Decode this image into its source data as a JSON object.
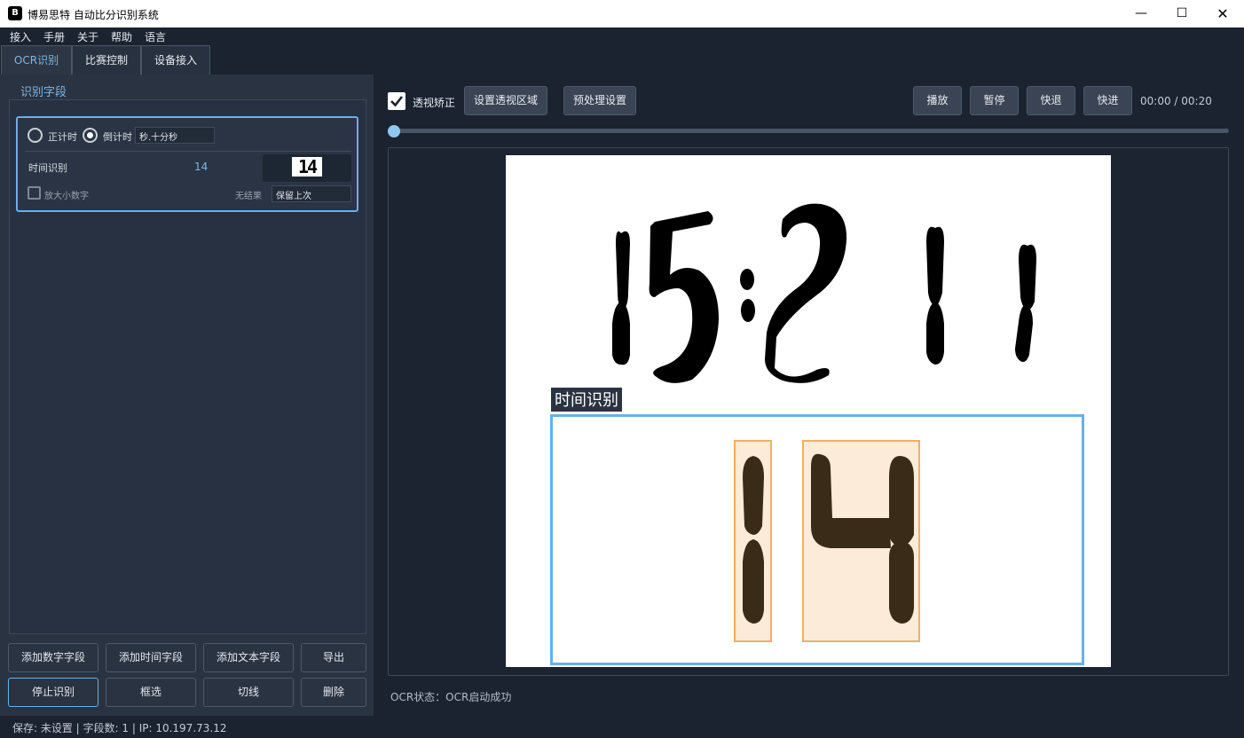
{
  "window": {
    "title": "博易思特 自动比分识别系统",
    "logo": "B",
    "minimize_icon": "minimize-icon",
    "maximize_icon": "maximize-icon",
    "close_icon": "close-icon"
  },
  "menu": [
    "接入",
    "手册",
    "关于",
    "帮助",
    "语言"
  ],
  "tabs": [
    {
      "label": "OCR识别",
      "active": true
    },
    {
      "label": "比赛控制",
      "active": false
    },
    {
      "label": "设备接入",
      "active": false
    }
  ],
  "left_panel": {
    "group_title": "识别字段",
    "field_card": {
      "count_up_label": "正计时",
      "count_down_label": "倒计时",
      "count_down_selected": true,
      "format_value": "秒.十分秒",
      "field_name": "时间识别",
      "field_value": "14",
      "preview_text": "14",
      "enlarge_label": "放大小数字",
      "enlarge_checked": false,
      "no_result_label": "无结果",
      "no_result_value": "保留上次"
    },
    "buttons_row1": [
      "添加数字字段",
      "添加时间字段",
      "添加文本字段",
      "导出"
    ],
    "buttons_row2": [
      "停止识别",
      "框选",
      "切线",
      "删除"
    ]
  },
  "toolbar": {
    "perspective_checked": true,
    "perspective_label": "透视矫正",
    "set_region_label": "设置透视区域",
    "preprocess_label": "预处理设置",
    "play_label": "播放",
    "pause_label": "暂停",
    "rewind_label": "快退",
    "forward_label": "快进",
    "time_display": "00:00 / 00:20",
    "progress": 0.0
  },
  "preview": {
    "scoreboard_text": "15:2 1 1",
    "region_label": "时间识别",
    "region_digits": "14"
  },
  "ocr_status": "OCR状态：OCR启动成功",
  "statusbar": "保存: 未设置 | 字段数: 1 | IP: 10.197.73.12",
  "colors": {
    "background": "#1b2330",
    "panel": "#2a3342",
    "accent": "#6ab0e6",
    "digit_box": "#f0b060"
  }
}
